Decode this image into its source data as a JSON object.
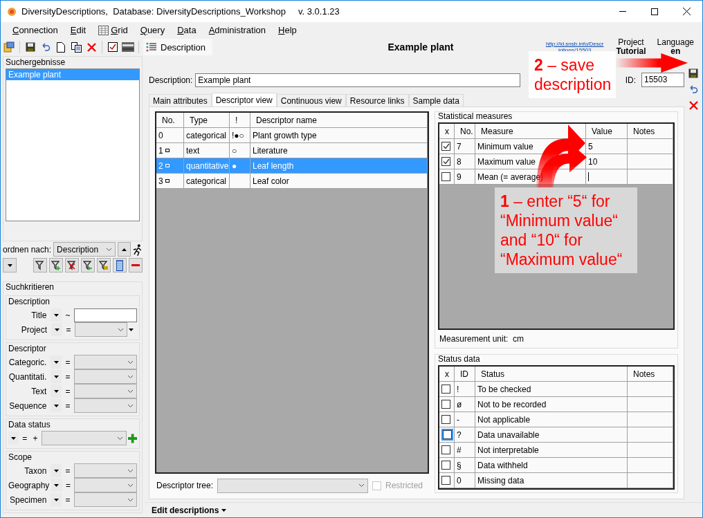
{
  "window": {
    "title": "DiversityDescriptions,  Database: DiversityDescriptions_Workshop",
    "version": "v. 3.0.1.23"
  },
  "menu": [
    {
      "label": "Connection",
      "kind": "plain"
    },
    {
      "label": "Edit",
      "kind": "plain"
    },
    {
      "label": "Grid",
      "kind": "grid"
    },
    {
      "label": "Query",
      "kind": "plain"
    },
    {
      "label": "Data",
      "kind": "plain"
    },
    {
      "label": "Administration",
      "kind": "plain"
    },
    {
      "label": "Help",
      "kind": "plain"
    }
  ],
  "toolbar": {
    "view_tab": "Description"
  },
  "header": {
    "title": "Example plant",
    "link": [
      "http://id.snsb.info/Descr",
      "iptions/15503"
    ],
    "project_label": "Project",
    "project": "Tutorial",
    "language_label": "Language",
    "language": "en"
  },
  "results": {
    "title": "Suchergebnisse",
    "items": [
      {
        "label": "Example plant",
        "selected": true
      }
    ]
  },
  "sort": {
    "label": "ordnen nach:",
    "value": "Description"
  },
  "search": {
    "title": "Suchkritieren",
    "groups": [
      {
        "title": "Description",
        "fields": [
          {
            "label": "Title",
            "op": "~",
            "kind": "text"
          },
          {
            "label": "Project",
            "op": "=",
            "kind": "select",
            "more": true
          }
        ]
      },
      {
        "title": "Descriptor",
        "fields": [
          {
            "label": "Categoric.",
            "op": "=",
            "kind": "select"
          },
          {
            "label": "Quantitati.",
            "op": "=",
            "kind": "select"
          },
          {
            "label": "Text",
            "op": "=",
            "kind": "select"
          },
          {
            "label": "Sequence",
            "op": "=",
            "kind": "select"
          }
        ]
      },
      {
        "title": "Data status",
        "fields": [
          {
            "op": "=",
            "extra": "+",
            "kind": "status"
          }
        ]
      },
      {
        "title": "Scope",
        "fields": [
          {
            "label": "Taxon",
            "op": "=",
            "kind": "select"
          },
          {
            "label": "Geography",
            "op": "=",
            "kind": "select"
          },
          {
            "label": "Specimen",
            "op": "=",
            "kind": "select"
          }
        ]
      }
    ]
  },
  "description": {
    "label": "Description:",
    "value": "Example plant",
    "id_label": "ID:",
    "id": "15503"
  },
  "tabs": [
    {
      "label": "Main attributes",
      "selected": false
    },
    {
      "label": "Descriptor view",
      "selected": true
    },
    {
      "label": "Continuous view",
      "selected": false
    },
    {
      "label": "Resource links",
      "selected": false
    },
    {
      "label": "Sample data",
      "selected": false
    }
  ],
  "descriptors": {
    "columns": [
      "No.",
      "Type",
      "!",
      "Descriptor name"
    ],
    "rows": [
      {
        "no": "0",
        "flag": false,
        "type": "categorical",
        "status": "!●○",
        "name": "Plant growth type",
        "selected": false
      },
      {
        "no": "1",
        "flag": true,
        "type": "text",
        "status": "○",
        "name": "Literature",
        "selected": false
      },
      {
        "no": "2",
        "flag": true,
        "type": "quantitative",
        "status": "●",
        "name": "Leaf length",
        "selected": true
      },
      {
        "no": "3",
        "flag": true,
        "type": "categorical",
        "name": "Leaf color",
        "selected": false
      }
    ]
  },
  "descriptor_tree": {
    "label": "Descriptor tree:",
    "restricted": {
      "label": "Restricted",
      "checked": false
    }
  },
  "statistics": {
    "title": "Statistical measures",
    "columns": [
      "x",
      "No.",
      "Measure",
      "Value",
      "Notes"
    ],
    "rows": [
      {
        "checked": true,
        "no": "7",
        "measure": "Minimum value",
        "value": "5"
      },
      {
        "checked": true,
        "no": "8",
        "measure": "Maximum value",
        "value": "10"
      },
      {
        "checked": false,
        "no": "9",
        "measure": "Mean (= average)",
        "editing": true
      }
    ],
    "unit_label": "Measurement unit:",
    "unit": "cm"
  },
  "status_data": {
    "title": "Status data",
    "columns": [
      "x",
      "ID",
      "Status",
      "Notes"
    ],
    "rows": [
      {
        "checked": false,
        "id": "!",
        "status": "To be checked"
      },
      {
        "checked": false,
        "id": "ø",
        "status": "Not to be recorded"
      },
      {
        "checked": false,
        "id": "-",
        "status": "Not applicable"
      },
      {
        "checked": false,
        "id": "?",
        "status": "Data unavailable",
        "focused": true
      },
      {
        "checked": false,
        "id": "#",
        "status": "Not interpretable"
      },
      {
        "checked": false,
        "id": "§",
        "status": "Data withheld"
      },
      {
        "checked": false,
        "id": "0",
        "status": "Missing data"
      }
    ]
  },
  "footer": {
    "label": "Edit descriptions"
  },
  "annotations": [
    {
      "kind": "save",
      "lines": [
        "**2** – save",
        "description"
      ]
    },
    {
      "kind": "enter",
      "lines": [
        "**1** – enter “5“ for",
        "“Minimum value“",
        "and “10“ for",
        "“Maximum value“"
      ]
    }
  ]
}
